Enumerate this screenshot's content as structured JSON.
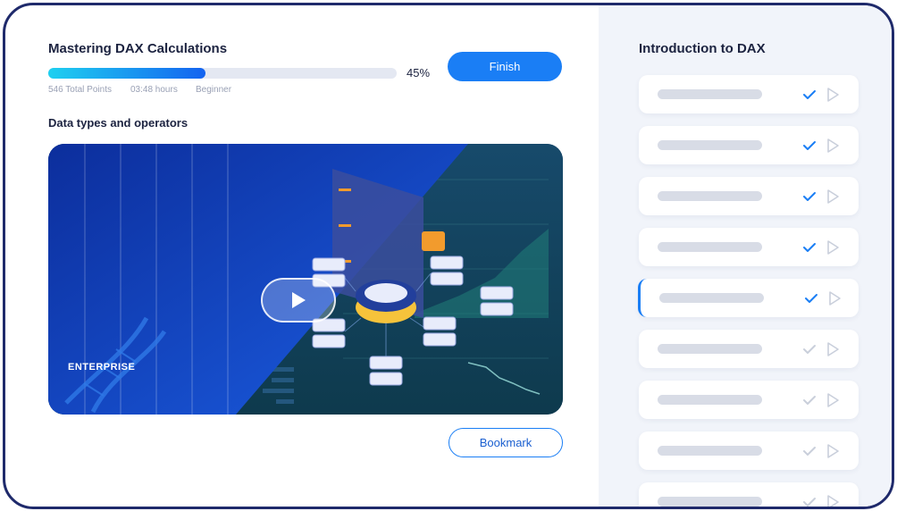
{
  "course": {
    "title": "Mastering DAX Calculations",
    "progress_percent": 45,
    "progress_label": "45%",
    "total_points": "546 Total Points",
    "duration": "03:48 hours",
    "level": "Beginner",
    "finish_label": "Finish"
  },
  "lesson": {
    "title": "Data types and operators",
    "bookmark_label": "Bookmark",
    "video": {
      "brand": "ENTERPRISE",
      "play_icon": "play-icon"
    }
  },
  "sidebar": {
    "title": "Introduction to DAX",
    "items": [
      {
        "completed": true
      },
      {
        "completed": true
      },
      {
        "completed": true
      },
      {
        "completed": true
      },
      {
        "completed": true,
        "active": true
      },
      {
        "completed": false
      },
      {
        "completed": false
      },
      {
        "completed": false
      },
      {
        "completed": false
      }
    ]
  },
  "colors": {
    "accent": "#1a7ef5",
    "frame_border": "#1f2a6b",
    "check_done": "#1a7ef5",
    "check_pending": "#c9cfdb",
    "progress_start": "#1fd0f0",
    "progress_end": "#1463f0"
  }
}
